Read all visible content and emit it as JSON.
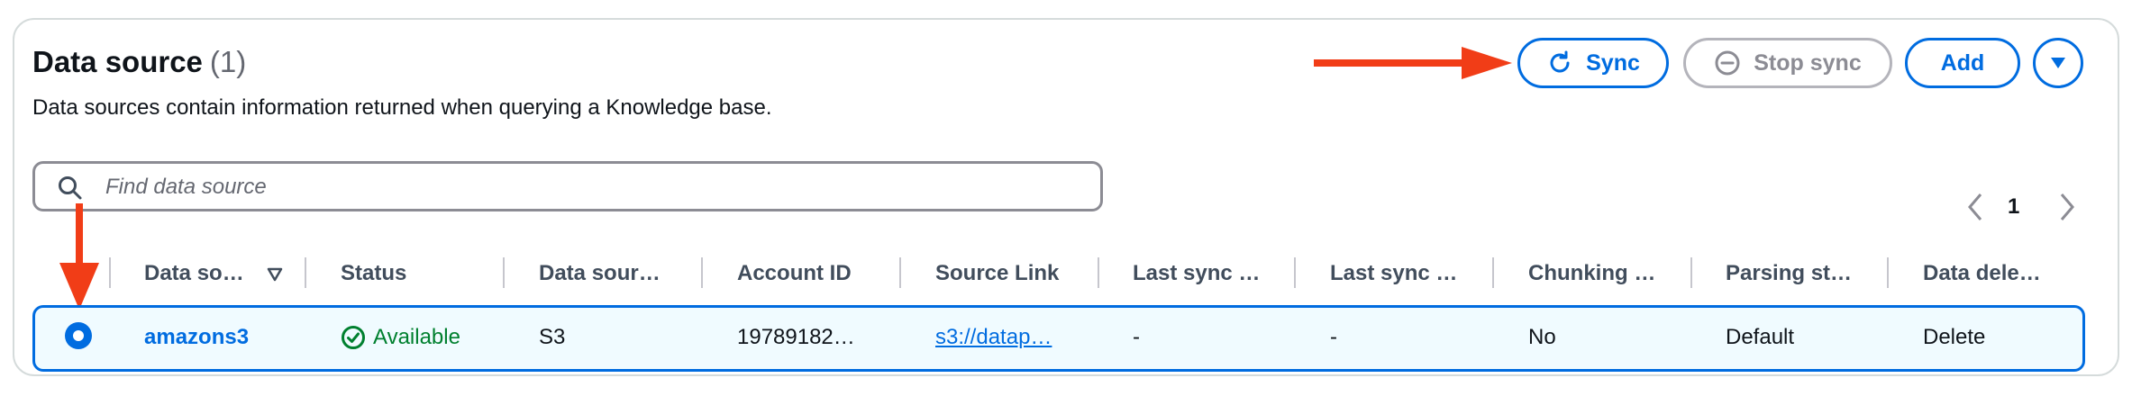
{
  "header": {
    "title": "Data source",
    "count": "(1)",
    "description": "Data sources contain information returned when querying a Knowledge base."
  },
  "actions": {
    "sync_label": "Sync",
    "stop_sync_label": "Stop sync",
    "add_label": "Add"
  },
  "search": {
    "placeholder": "Find data source",
    "value": ""
  },
  "pagination": {
    "current_page": "1"
  },
  "table": {
    "columns": [
      "Data so…",
      "Status",
      "Data sour…",
      "Account ID",
      "Source Link",
      "Last sync …",
      "Last sync …",
      "Chunking …",
      "Parsing st…",
      "Data dele…"
    ],
    "rows": [
      {
        "name": "amazons3",
        "status": "Available",
        "type": "S3",
        "account_id": "19789182…",
        "source_link": "s3://datap…",
        "last_sync_1": "-",
        "last_sync_2": "-",
        "chunking": "No",
        "parsing": "Default",
        "deletion": "Delete"
      }
    ]
  },
  "colors": {
    "accent": "#006ce0",
    "success": "#00802f",
    "annotation": "#f13d17"
  }
}
